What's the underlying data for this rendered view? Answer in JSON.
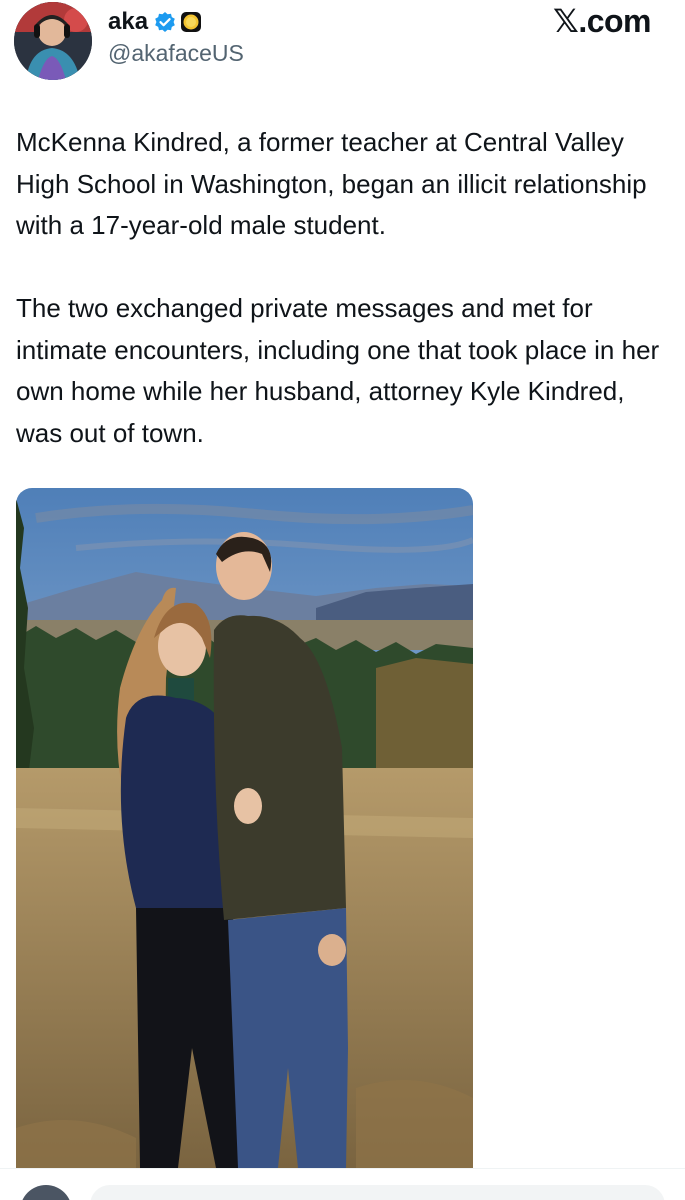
{
  "author": {
    "display_name": "aka",
    "handle": "@akafaceUS",
    "verified": true,
    "avatar_icon": "profile-avatar"
  },
  "header": {
    "site_label": "𝕏.com"
  },
  "tweet": {
    "paragraphs": [
      "McKenna Kindred, a former teacher at Central Valley High School in Washington, began an illicit relationship with a 17-year-old male student.",
      "The two exchanged private messages and met for intimate encounters, including one that took place in her own home while her husband, attorney Kyle Kindred, was out of town."
    ]
  },
  "media": {
    "type": "photo"
  },
  "colors": {
    "verified_blue": "#1d9bf0",
    "badge_gold": "#f4c430",
    "text_primary": "#0f1419",
    "text_secondary": "#536471"
  }
}
